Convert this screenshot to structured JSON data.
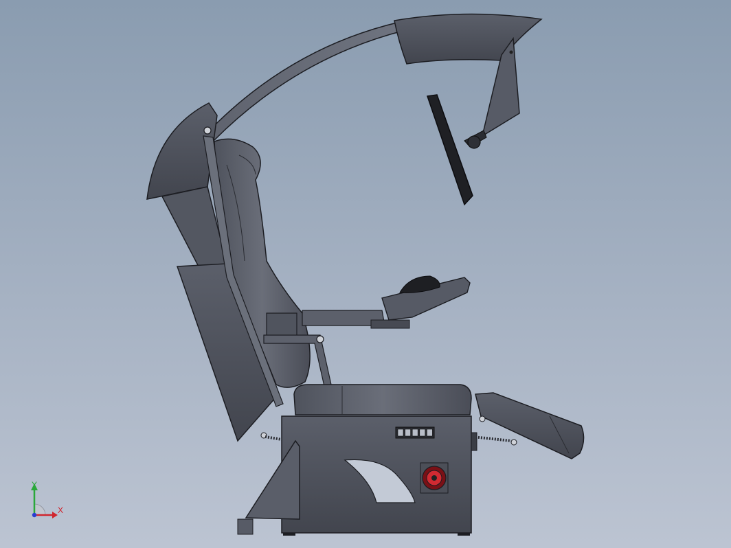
{
  "view": {
    "background_top": "#8a9cb0",
    "background_bottom": "#bcc4d2",
    "body_color": "#4a4d57",
    "edge_color": "#1c1d22",
    "accent_red": "#c8202a"
  },
  "triad": {
    "x_label": "X",
    "y_label": "Y",
    "x_color": "#d0262e",
    "y_color": "#2aa83a",
    "z_color": "#2a3ed0"
  },
  "base_panel": {
    "counter_cells": 5
  }
}
